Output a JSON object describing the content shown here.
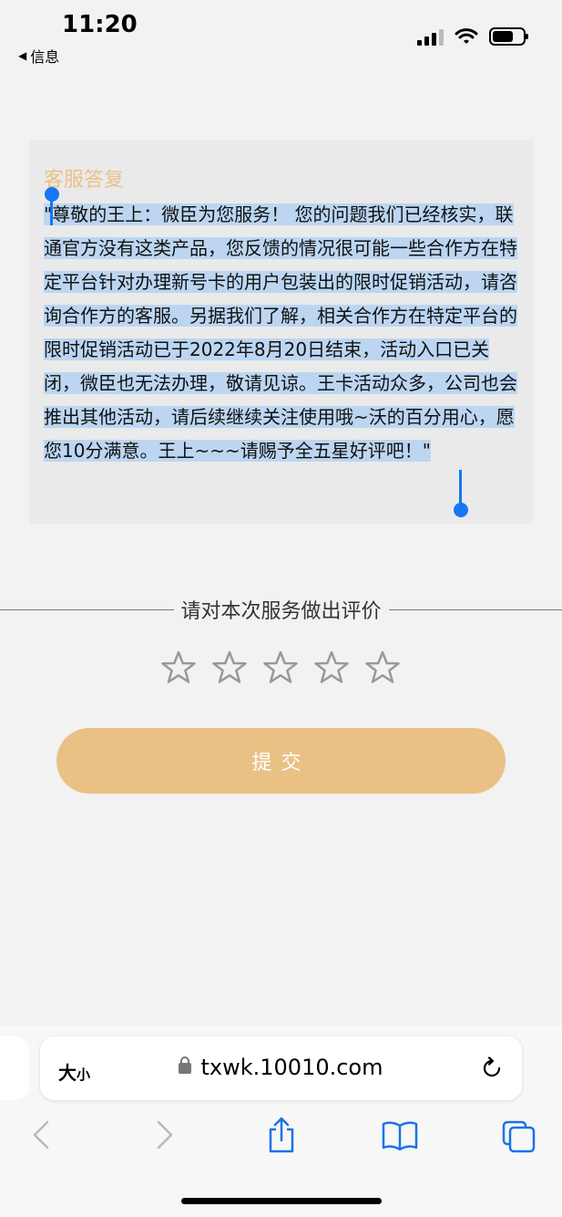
{
  "status": {
    "time": "11:20",
    "back_label": "信息"
  },
  "reply": {
    "title": "客服答复",
    "text": "\"尊敬的王上：微臣为您服务！ 您的问题我们已经核实，联通官方没有这类产品，您反馈的情况很可能一些合作方在特定平台针对办理新号卡的用户包装出的限时促销活动，请咨询合作方的客服。另据我们了解，相关合作方在特定平台的限时促销活动已于2022年8月20日结束，活动入口已关闭，微臣也无法办理，敬请见谅。王卡活动众多，公司也会推出其他活动，请后续继续关注使用哦~沃的百分用心，愿您10分满意。王上~~~请赐予全五星好评吧！\""
  },
  "rating": {
    "label": "请对本次服务做出评价",
    "stars_total": 5,
    "stars_selected": 0
  },
  "submit": {
    "label": "提交"
  },
  "browser": {
    "text_size_label": "大",
    "text_size_small": "小",
    "url": "txwk.10010.com"
  },
  "colors": {
    "accent": "#e9c185",
    "selection": "#bcd6f2",
    "handle": "#1677f2",
    "ios_blue": "#1a73e8"
  },
  "icons": [
    "signal-icon",
    "wifi-icon",
    "battery-icon",
    "star-icon",
    "lock-icon",
    "reload-icon",
    "back-icon",
    "forward-icon",
    "share-icon",
    "bookmarks-icon",
    "tabs-icon"
  ]
}
